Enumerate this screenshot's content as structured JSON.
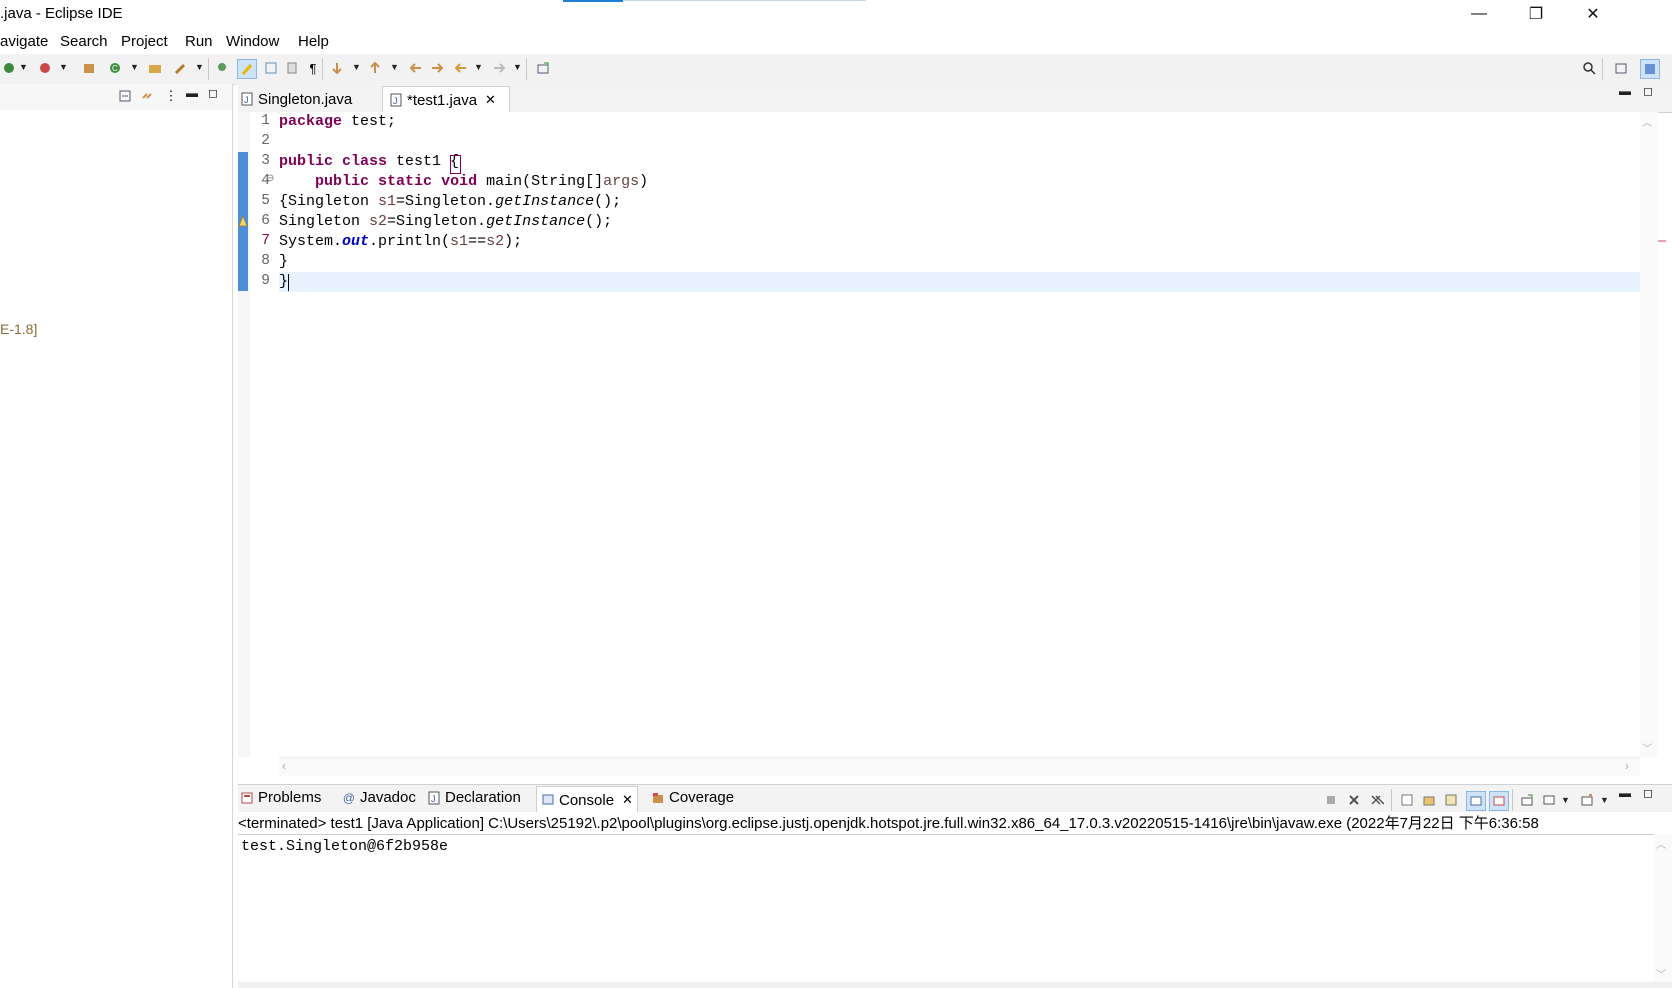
{
  "window": {
    "title": ".java - Eclipse IDE",
    "minimize_glyph": "—",
    "restore_glyph": "❐",
    "close_glyph": "✕"
  },
  "menu": {
    "items": [
      "avigate",
      "Search",
      "Project",
      "Run",
      "Window",
      "Help"
    ]
  },
  "left_panel": {
    "jre_label": "E-1.8]"
  },
  "editor": {
    "tabs": [
      {
        "label": "Singleton.java",
        "active": false
      },
      {
        "label": "*test1.java",
        "active": true,
        "close": "✕"
      }
    ],
    "line_numbers": [
      "1",
      "2",
      "3",
      "4",
      "5",
      "6",
      "7",
      "8",
      "9"
    ],
    "fold_marker": "⊖",
    "code": {
      "l1_kw": "package",
      "l1_rest": " test;",
      "l3_kw1": "public",
      "l3_kw2": "class",
      "l3_rest": " test1 {",
      "l4_indent": "    ",
      "l4_kw1": "public",
      "l4_kw2": "static",
      "l4_kw3": "void",
      "l4_rest": " main(String[]",
      "l4_var": "args",
      "l4_end": ")",
      "l5_a": "{Singleton ",
      "l5_var": "s1",
      "l5_b": "=Singleton.",
      "l5_m": "getInstance",
      "l5_c": "();",
      "l6_a": "Singleton ",
      "l6_var": "s2",
      "l6_b": "=Singleton.",
      "l6_m": "getInstance",
      "l6_c": "();",
      "l7_a": "System.",
      "l7_fld": "out",
      "l7_b": ".println(",
      "l7_v1": "s1",
      "l7_op": "==",
      "l7_v2": "s2",
      "l7_c": ");",
      "l8": "}",
      "l9": "}"
    }
  },
  "bottom_panel": {
    "tabs": [
      {
        "label": "Problems"
      },
      {
        "label": "Javadoc"
      },
      {
        "label": "Declaration"
      },
      {
        "label": "Console",
        "active": true,
        "close": "✕"
      },
      {
        "label": "Coverage"
      }
    ],
    "status": "<terminated> test1 [Java Application] C:\\Users\\25192\\.p2\\pool\\plugins\\org.eclipse.justj.openjdk.hotspot.jre.full.win32.x86_64_17.0.3.v20220515-1416\\jre\\bin\\javaw.exe  (2022年7月22日 下午6:36:58",
    "output": "test.Singleton@6f2b958e"
  },
  "colors": {
    "keyword": "#7f0055",
    "variable": "#6a3e3e",
    "field": "#0000c0",
    "change_bar": "#4f8fd9",
    "current_line": "#e8f2fe",
    "jre_label": "#8a6d3b"
  }
}
